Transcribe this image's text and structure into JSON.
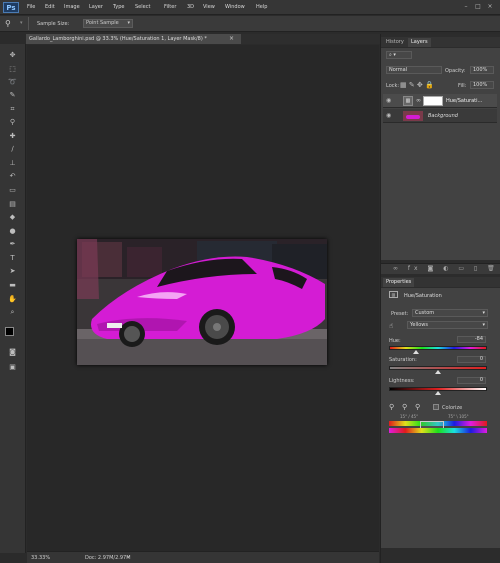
{
  "app": {
    "logo": "Ps"
  },
  "menu": [
    "File",
    "Edit",
    "Image",
    "Layer",
    "Type",
    "Select",
    "Filter",
    "3D",
    "View",
    "Window",
    "Help"
  ],
  "window_controls": {
    "minimize": "–",
    "maximize": "□",
    "close": "×"
  },
  "options_bar": {
    "sample_size_label": "Sample Size:",
    "sample_size_value": "Point Sample"
  },
  "document_tab": {
    "title": "Gallardo_Lamborghini.psd @ 33.3% (Hue/Saturation 1, Layer Mask/8) *",
    "close": "×"
  },
  "status_bar": {
    "zoom": "33.33%",
    "doc_info": "Doc: 2.97M/2.97M"
  },
  "layers_panel": {
    "tabs": [
      "History",
      "Layers"
    ],
    "blend_mode": "Normal",
    "opacity_label": "Opacity:",
    "opacity_value": "100%",
    "lock_label": "Lock:",
    "fill_label": "Fill:",
    "fill_value": "100%",
    "layers": [
      {
        "name": "Hue/Saturati...",
        "selected": true
      },
      {
        "name": "Background",
        "selected": false
      }
    ]
  },
  "properties_panel": {
    "tabs": [
      "Properties"
    ],
    "title": "Hue/Saturation",
    "preset_label": "Preset:",
    "preset_value": "Custom",
    "channel_value": "Yellows",
    "hue_label": "Hue:",
    "hue_value": "-84",
    "hue_fraction": 0.27,
    "saturation_label": "Saturation:",
    "saturation_value": "0",
    "saturation_fraction": 0.5,
    "lightness_label": "Lightness:",
    "lightness_value": "0",
    "lightness_fraction": 0.5,
    "colorize_label": "Colorize",
    "range_left": "15° / 45°",
    "range_right": "75° \\ 105°"
  },
  "colors": {
    "accent": "#e020e0",
    "ui_dark": "#2b2b2b"
  }
}
